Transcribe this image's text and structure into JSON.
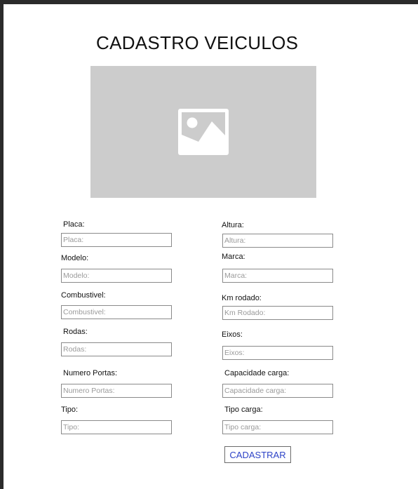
{
  "page": {
    "title": "CADASTRO VEICULOS"
  },
  "image_placeholder": {
    "icon": "image-icon",
    "color": "#cccccc"
  },
  "form": {
    "left": [
      {
        "key": "placa",
        "label": "Placa:",
        "placeholder": "Placa:"
      },
      {
        "key": "modelo",
        "label": "Modelo:",
        "placeholder": "Modelo:"
      },
      {
        "key": "combustivel",
        "label": "Combustivel:",
        "placeholder": "Combustivel:"
      },
      {
        "key": "rodas",
        "label": "Rodas:",
        "placeholder": "Rodas:"
      },
      {
        "key": "numero-portas",
        "label": "Numero Portas:",
        "placeholder": "Numero Portas:"
      },
      {
        "key": "tipo",
        "label": "Tipo:",
        "placeholder": "Tipo:"
      }
    ],
    "right": [
      {
        "key": "altura",
        "label": "Altura:",
        "placeholder": "Altura:"
      },
      {
        "key": "marca",
        "label": "Marca:",
        "placeholder": "Marca:"
      },
      {
        "key": "km-rodado",
        "label": "Km rodado:",
        "placeholder": "Km Rodado:"
      },
      {
        "key": "eixos",
        "label": "Eixos:",
        "placeholder": "Eixos:"
      },
      {
        "key": "capacidade-carga",
        "label": "Capacidade carga:",
        "placeholder": "Capacidade carga:"
      },
      {
        "key": "tipo-carga",
        "label": "Tipo carga:",
        "placeholder": "Tipo carga:"
      }
    ],
    "submit_label": "CADASTRAR",
    "submit_color": "#2d43c7"
  }
}
